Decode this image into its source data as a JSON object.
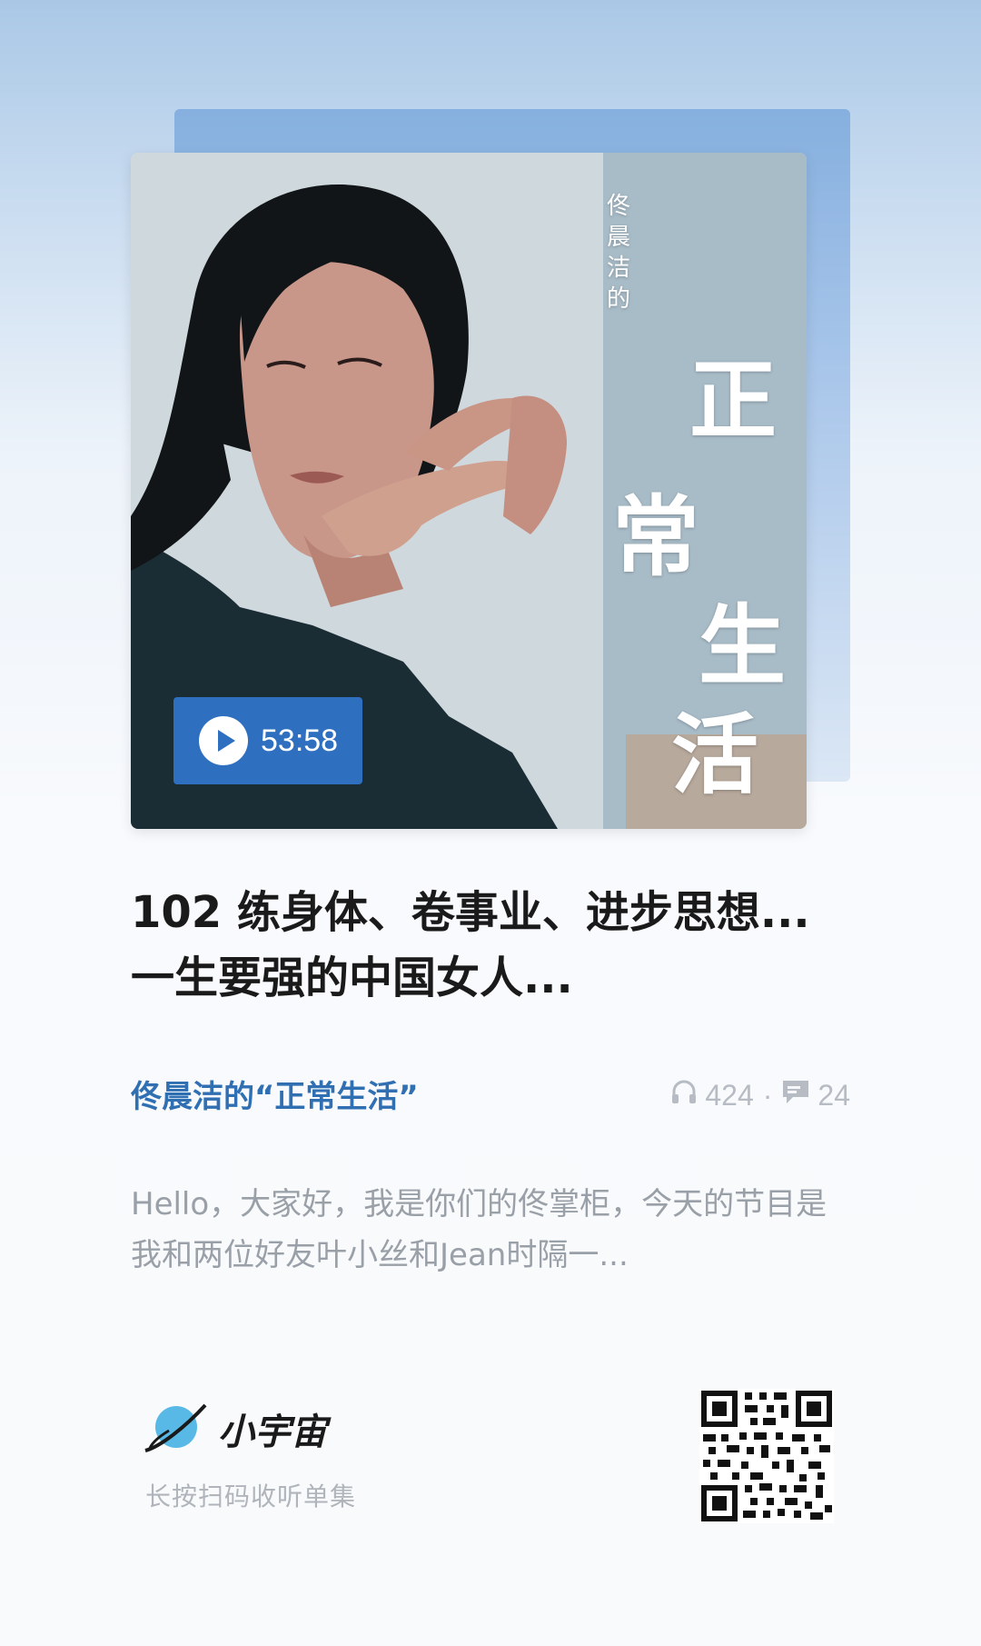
{
  "cover": {
    "small_title": "佟晨洁的",
    "big_title_chars": [
      "正",
      "常",
      "生",
      "活"
    ],
    "play_duration": "53:58"
  },
  "episode": {
    "title": "102 练身体、卷事业、进步思想...一生要强的中国女人...",
    "podcast_name": "佟晨洁的“正常生活”",
    "listens": "424",
    "separator": "·",
    "comments": "24",
    "description": "Hello，大家好，我是你们的佟掌柜，今天的节目是我和两位好友叶小丝和Jean时隔一..."
  },
  "footer": {
    "brand_name": "小宇宙",
    "scan_hint": "长按扫码收听单集"
  },
  "colors": {
    "accent_blue": "#2e6fc0",
    "podcast_link": "#2f6fb2",
    "muted_text": "#9aa0a8"
  },
  "icons": [
    "play-icon",
    "headphone-icon",
    "comment-icon",
    "planet-logo-icon",
    "qr-code"
  ]
}
